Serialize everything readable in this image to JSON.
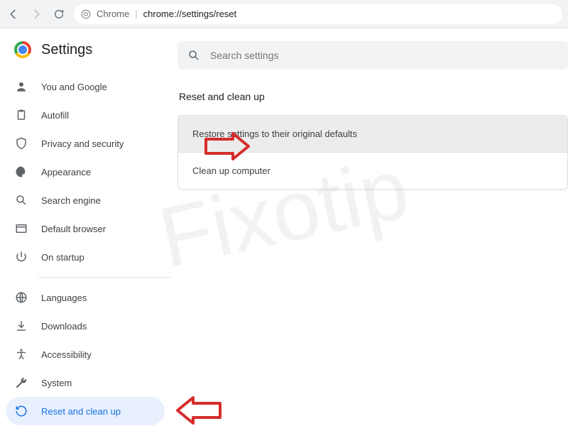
{
  "toolbar": {
    "label": "Chrome",
    "url": "chrome://settings/reset"
  },
  "page_title": "Settings",
  "search": {
    "placeholder": "Search settings"
  },
  "sidebar": {
    "group1": [
      {
        "label": "You and Google"
      },
      {
        "label": "Autofill"
      },
      {
        "label": "Privacy and security"
      },
      {
        "label": "Appearance"
      },
      {
        "label": "Search engine"
      },
      {
        "label": "Default browser"
      },
      {
        "label": "On startup"
      }
    ],
    "group2": [
      {
        "label": "Languages"
      },
      {
        "label": "Downloads"
      },
      {
        "label": "Accessibility"
      },
      {
        "label": "System"
      },
      {
        "label": "Reset and clean up"
      }
    ]
  },
  "main": {
    "section_title": "Reset and clean up",
    "rows": [
      {
        "label": "Restore settings to their original defaults"
      },
      {
        "label": "Clean up computer"
      }
    ]
  },
  "watermark": "Fixotip"
}
